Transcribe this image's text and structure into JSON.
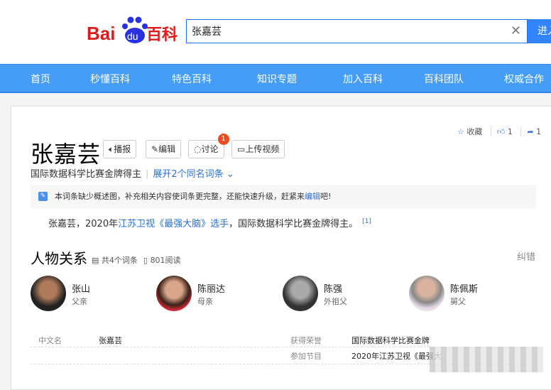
{
  "header": {
    "logo_text": "Bai du 百科",
    "search_value": "张嘉芸",
    "search_button": "进入词条"
  },
  "nav": [
    "首页",
    "秒懂百科",
    "特色百科",
    "知识专题",
    "加入百科",
    "百科团队",
    "权威合作"
  ],
  "actions": {
    "collect": "收藏",
    "like_count": "1",
    "share_count": "1"
  },
  "entry": {
    "title": "张嘉芸",
    "buttons": [
      "播报",
      "编辑",
      "讨论",
      "上传视频"
    ],
    "discussion_badge": "1",
    "subtitle": "国际数据科学比赛金牌得主",
    "expand": "展开2个同名词条"
  },
  "notice": {
    "before": "本词条缺少概述图，补充相关内容使词条更完整，还能快速升级，赶紧来",
    "link": "编辑",
    "after": "吧!"
  },
  "summary": {
    "p1": "张嘉芸，2020年",
    "link1": "江苏卫视",
    "p2": "《最强大脑》",
    "link2": "选手",
    "p3": "，国际数据科学比赛金牌得主。",
    "ref": "[1]"
  },
  "relations": {
    "title": "人物关系",
    "count": "共4个词条",
    "reads": "801阅读",
    "correct": "纠错",
    "people": [
      {
        "name": "张山",
        "relation": "父亲"
      },
      {
        "name": "陈丽达",
        "relation": "母亲"
      },
      {
        "name": "陈强",
        "relation": "外祖父"
      },
      {
        "name": "陈佩斯",
        "relation": "舅父"
      }
    ]
  },
  "info": [
    {
      "label": "中文名",
      "value": "张嘉芸"
    },
    {
      "label": "获得荣誉",
      "value": "国际数据科学比赛金牌"
    },
    {
      "label": "参加节目",
      "value": "2020年江苏卫视《最强大"
    }
  ]
}
